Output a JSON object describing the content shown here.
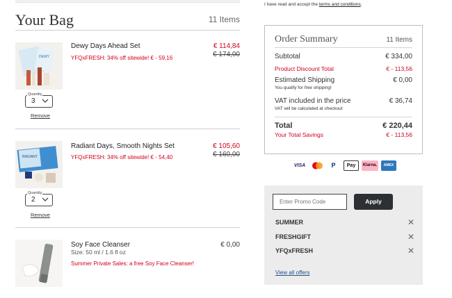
{
  "bag": {
    "title": "Your Bag",
    "count": "11 Items",
    "quantity_label": "Quantity",
    "remove_label": "Remove",
    "items": [
      {
        "name": "Dewy Days Ahead Set",
        "promo": "YFQxFRESH: 34% off sitewide! € - 59,16",
        "price": "€ 114,84",
        "old_price": "€ 174,00",
        "quantity": "3"
      },
      {
        "name": "Radiant Days, Smooth Nights Set",
        "promo": "YFQxFRESH: 34% off sitewide! € - 54,40",
        "price": "€ 105,60",
        "old_price": "€ 160,00",
        "quantity": "2"
      },
      {
        "name": "Soy Face Cleanser",
        "size": "Size: 50 ml / 1.6 fl oz",
        "promo": "Summer Private Sales: a free Soy Face Cleanser!",
        "price": "€ 0,00"
      }
    ]
  },
  "terms": {
    "prefix": "I have read and accept the ",
    "link": "terms and conditions",
    "suffix": "."
  },
  "summary": {
    "title": "Order Summary",
    "count": "11 Items",
    "subtotal_label": "Subtotal",
    "subtotal_value": "€ 334,00",
    "discount_label": "Product Discount Total",
    "discount_value": "€ - 113,56",
    "shipping_label": "Estimated Shipping",
    "shipping_value": "€ 0,00",
    "shipping_note": "You qualify for free shipping!",
    "vat_label": "VAT included in the price",
    "vat_value": "€ 36,74",
    "vat_note": "VAT will be calculated at checkout",
    "total_label": "Total",
    "total_value": "€ 220,44",
    "savings_label": "Your Total Savings",
    "savings_value": "€ - 113,56"
  },
  "payment_methods": [
    "VISA",
    "Mastercard",
    "PayPal",
    "Pay",
    "Klarna.",
    "AMEX"
  ],
  "offers": {
    "placeholder": "Enter Promo Code",
    "apply_label": "Apply",
    "codes": [
      "SUMMER",
      "FRESHGIFT",
      "YFQxFRESH"
    ],
    "view_all": "View all offers"
  },
  "colors": {
    "sale_red": "#d0021b",
    "button_dark": "#2c3034",
    "link_blue": "#1f4f8f"
  }
}
